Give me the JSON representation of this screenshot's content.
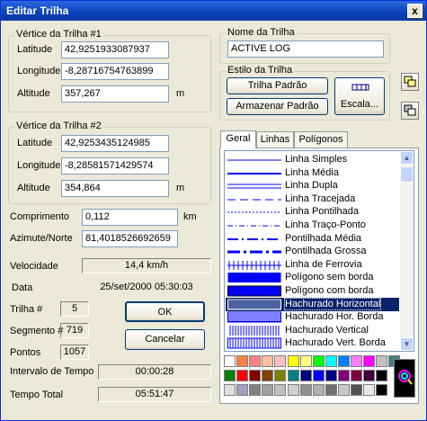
{
  "window": {
    "title": "Editar Trilha",
    "close": "x"
  },
  "vertex1": {
    "legend": "Vértice da Trilha #1",
    "lat_label": "Latitude",
    "lat": "42,9251933087937",
    "lon_label": "Longitude",
    "lon": "-8,28716754763899",
    "alt_label": "Altitude",
    "alt": "357,267",
    "alt_unit": "m"
  },
  "vertex2": {
    "legend": "Vértice da Trilha #2",
    "lat_label": "Latitude",
    "lat": "42,9253435124985",
    "lon_label": "Longitude",
    "lon": "-8,28581571429574",
    "alt_label": "Altitude",
    "alt": "354,864",
    "alt_unit": "m"
  },
  "length": {
    "label": "Comprimento",
    "value": "0,112",
    "unit": "km"
  },
  "azimuth": {
    "label": "Azimute/Norte",
    "value": "81,4018526692659"
  },
  "speed": {
    "label": "Velocidade",
    "value": "14,4 km/h"
  },
  "date": {
    "label": "Data",
    "value": "25/set/2000   05:30:03"
  },
  "track": {
    "label": "Trilha #",
    "value": "5"
  },
  "segment": {
    "label": "Segmento #",
    "value": "719"
  },
  "points": {
    "label": "Pontos",
    "value": "1057"
  },
  "interval": {
    "label": "Intervalo de Tempo",
    "value": "00:00:28"
  },
  "total": {
    "label": "Tempo Total",
    "value": "05:51:47"
  },
  "buttons": {
    "ok": "OK",
    "cancel": "Cancelar"
  },
  "name": {
    "legend": "Nome da Trilha",
    "value": "ACTIVE LOG"
  },
  "style": {
    "legend": "Estilo da Trilha",
    "default_btn": "Trilha Padrão",
    "store_btn": "Armazenar Padrão",
    "scale_btn": "Escala..."
  },
  "tabs": [
    "Geral",
    "Linhas",
    "Polígonos"
  ],
  "line_styles": [
    {
      "label": "Linha Simples",
      "kind": "thin"
    },
    {
      "label": "Linha Média",
      "kind": "medium"
    },
    {
      "label": "Linha Dupla",
      "kind": "double"
    },
    {
      "label": "Linha Tracejada",
      "kind": "dashed"
    },
    {
      "label": "Linha Pontilhada",
      "kind": "dotted"
    },
    {
      "label": "Linha Traço-Ponto",
      "kind": "dashdot"
    },
    {
      "label": "Pontilhada Média",
      "kind": "dotmed"
    },
    {
      "label": "Pontilhada Grossa",
      "kind": "dotthick"
    },
    {
      "label": "Linha de Ferrovia",
      "kind": "rail"
    },
    {
      "label": "Polígono sem borda",
      "kind": "fill"
    },
    {
      "label": "Polígono com borda",
      "kind": "fillborder"
    },
    {
      "label": "Hachurado Horizontal",
      "kind": "hatchh"
    },
    {
      "label": "Hachurado Hor. Borda",
      "kind": "hatchhb"
    },
    {
      "label": "Hachurado Vertical",
      "kind": "hatchv"
    },
    {
      "label": "Hachurado Vert. Borda",
      "kind": "hatchvb"
    }
  ],
  "selected_style": "Hachurado Horizontal",
  "line_color": "#0000ff",
  "palette": [
    [
      "#ffffff",
      "#ff8040",
      "#ff8080",
      "#ffc0a0",
      "#ffc0c0",
      "#ffff00",
      "#ffff80",
      "#00ff00",
      "#00ffff",
      "#0080ff",
      "#ff80ff",
      "#ff00ff",
      "#c0c0c0",
      "#408080"
    ],
    [
      "#008000",
      "#ff0000",
      "#800000",
      "#804000",
      "#808000",
      "#008080",
      "#000080",
      "#0000ff",
      "#000080",
      "#800080",
      "#800040",
      "#400040",
      "#000000"
    ],
    [
      "#e0e0e0",
      "#a0a0c0",
      "#808080",
      "#a0a0a0",
      "#c0c0c0",
      "#d0d0d0",
      "#909090",
      "#b0b0b0",
      "#707070",
      "#c8c8c8",
      "#505050",
      "#e8e8e8",
      "#000000"
    ]
  ],
  "icons": [
    "close-icon",
    "copy-style-icon",
    "paste-style-icon",
    "scale-icon",
    "color-picker-icon",
    "scroll-up-icon",
    "scroll-down-icon"
  ]
}
